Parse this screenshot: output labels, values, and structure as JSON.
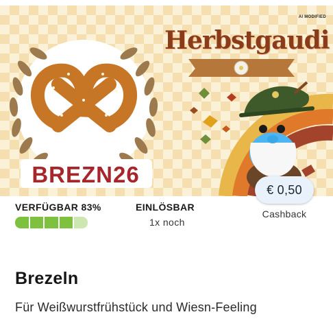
{
  "banner": {
    "ai_badge": "AI MODIFIED",
    "title": "Herbstgaudi",
    "promo_code": "BREZN26"
  },
  "stats": {
    "availability_label": "VERFÜGBAR 83%",
    "availability_level": 0.83,
    "redeemable_label": "EINLÖSBAR",
    "redeemable_value": "1x noch"
  },
  "price": {
    "amount": "€ 0,50",
    "type": "Cashback"
  },
  "product": {
    "title": "Brezeln",
    "description": "Für Weißwurstfrühstück und Wiesn-Feeling"
  },
  "colors": {
    "banner_bg": "#fbf1d7",
    "title_brown": "#8a3b1a",
    "code_red": "#a5262b",
    "progress_green": "#7ec13f",
    "progress_light": "#cde7b0",
    "pill_bg": "#e9f2fb"
  },
  "icons": [
    "laurel-wreath",
    "pretzel",
    "autumn-leaves",
    "gnome-mascot",
    "edelweiss-ribbon"
  ]
}
